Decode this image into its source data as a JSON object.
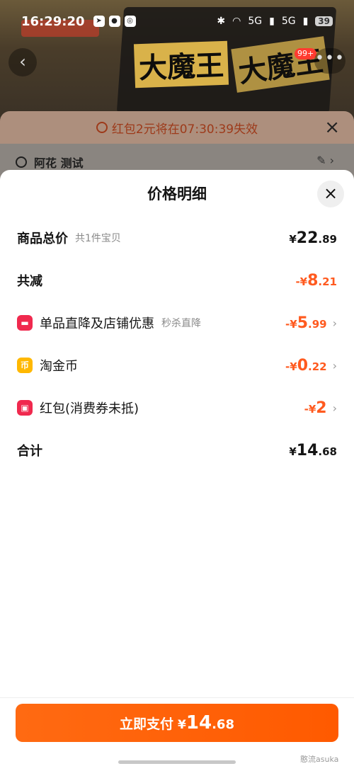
{
  "status_bar": {
    "time": "16:29:20",
    "network": "5G",
    "battery": "39"
  },
  "background": {
    "banner_text": "大魔王",
    "badge": "99+"
  },
  "promo": {
    "countdown_text": "红包2元将在07:30:39失效"
  },
  "address": {
    "name": "阿花 测试"
  },
  "modal": {
    "title": "价格明细",
    "close_icon": "×"
  },
  "rows": [
    {
      "label": "商品总价",
      "sub": "共1件宝贝",
      "currency": "¥",
      "int": "22",
      "dec": ".89"
    },
    {
      "label": "共减",
      "currency": "-¥",
      "int": "8",
      "dec": ".21"
    },
    {
      "label": "单品直降及店铺优惠",
      "sub": "秒杀直降",
      "currency": "-¥",
      "int": "5",
      "dec": ".99"
    },
    {
      "label": "淘金币",
      "currency": "-¥",
      "int": "0",
      "dec": ".22"
    },
    {
      "label": "红包(消费券未抵)",
      "currency": "-¥",
      "int": "2",
      "dec": ""
    },
    {
      "label": "合计",
      "currency": "¥",
      "int": "14",
      "dec": ".68"
    }
  ],
  "pay": {
    "label": "立即支付",
    "currency": "¥",
    "int": "14",
    "dec": ".68"
  },
  "watermark": "憨流asuka",
  "colors": {
    "orange": "#ff5a1f",
    "button": "#ff6a12",
    "coin": "#ffb800",
    "red": "#f0294e"
  }
}
